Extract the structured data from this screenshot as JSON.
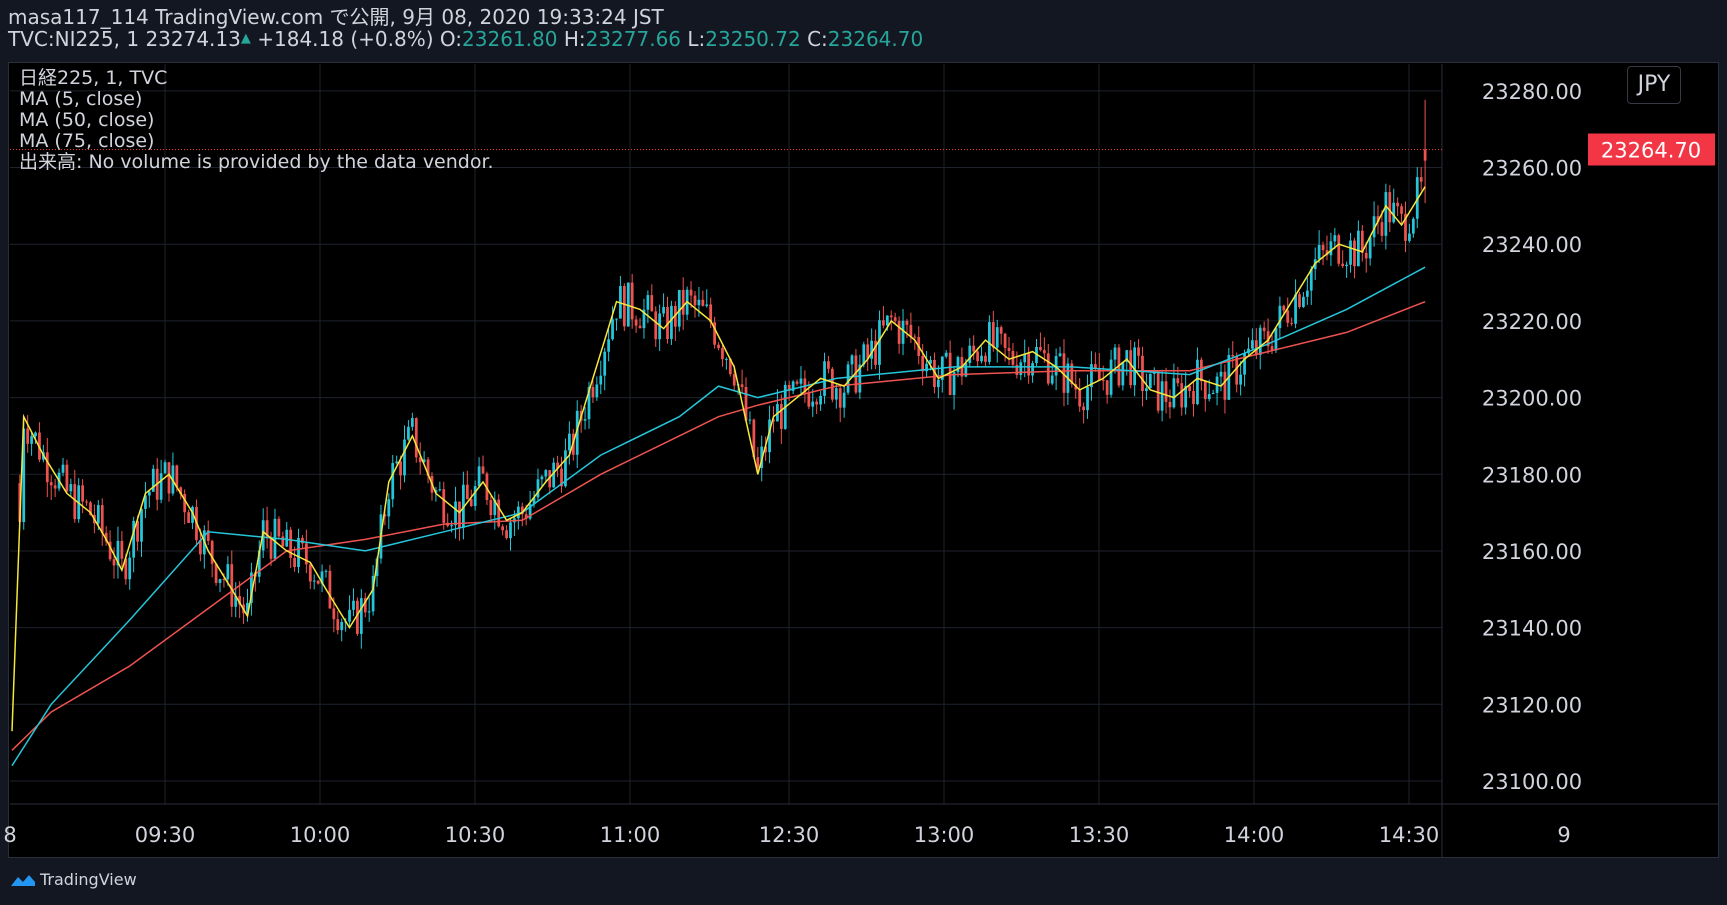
{
  "header": {
    "line1": "masa117_114 TradingView.com で公開, 9月 08, 2020 19:33:24 JST",
    "symbol": "TVC:NI225, 1",
    "last": "23274.13",
    "change": "+184.18 (+0.8%)",
    "o_label": "O:",
    "o_val": "23261.80",
    "h_label": "H:",
    "h_val": "23277.66",
    "l_label": "L:",
    "l_val": "23250.72",
    "c_label": "C:",
    "c_val": "23264.70"
  },
  "legend": {
    "title": "日経225, 1, TVC",
    "ma5": "MA (5, close)",
    "ma50": "MA (50, close)",
    "ma75": "MA (75, close)",
    "volume": "出来高: No volume is provided by the data vendor."
  },
  "currency_button": "JPY",
  "last_price_label": "23264.70",
  "brand": "TradingView",
  "colors": {
    "up": "#26c6da",
    "down": "#ef5350",
    "ma5": "#f5e73b",
    "ma50": "#26c6da",
    "ma75": "#ef5350",
    "last_price_bg": "#f23645",
    "header_value": "#26a69a"
  },
  "chart_data": {
    "type": "candlestick",
    "ylim": [
      23094,
      23287
    ],
    "y_ticks": [
      23100,
      23120,
      23140,
      23160,
      23180,
      23200,
      23220,
      23240,
      23260,
      23280
    ],
    "y_tick_labels": [
      "23100.00",
      "23120.00",
      "23140.00",
      "23160.00",
      "23180.00",
      "23200.00",
      "23220.00",
      "23240.00",
      "23260.00",
      "23280.00"
    ],
    "x_tick_labels": [
      "8",
      "09:30",
      "10:00",
      "10:30",
      "11:00",
      "12:30",
      "13:00",
      "13:30",
      "14:00",
      "14:30",
      "9"
    ],
    "last_price": 23264.7,
    "ma5_points": [
      [
        0,
        23113
      ],
      [
        3,
        23195
      ],
      [
        8,
        23185
      ],
      [
        14,
        23175
      ],
      [
        20,
        23170
      ],
      [
        24,
        23163
      ],
      [
        28,
        23155
      ],
      [
        34,
        23175
      ],
      [
        40,
        23180
      ],
      [
        46,
        23170
      ],
      [
        50,
        23160
      ],
      [
        56,
        23150
      ],
      [
        60,
        23143
      ],
      [
        64,
        23165
      ],
      [
        70,
        23160
      ],
      [
        76,
        23157
      ],
      [
        80,
        23150
      ],
      [
        86,
        23140
      ],
      [
        92,
        23150
      ],
      [
        96,
        23178
      ],
      [
        102,
        23190
      ],
      [
        108,
        23175
      ],
      [
        114,
        23170
      ],
      [
        120,
        23178
      ],
      [
        126,
        23168
      ],
      [
        130,
        23170
      ],
      [
        136,
        23178
      ],
      [
        142,
        23185
      ],
      [
        148,
        23205
      ],
      [
        154,
        23225
      ],
      [
        160,
        23223
      ],
      [
        166,
        23218
      ],
      [
        172,
        23225
      ],
      [
        178,
        23220
      ],
      [
        184,
        23208
      ],
      [
        190,
        23180
      ],
      [
        194,
        23195
      ],
      [
        200,
        23200
      ],
      [
        206,
        23205
      ],
      [
        212,
        23203
      ],
      [
        218,
        23210
      ],
      [
        224,
        23220
      ],
      [
        230,
        23215
      ],
      [
        236,
        23205
      ],
      [
        242,
        23208
      ],
      [
        248,
        23215
      ],
      [
        254,
        23210
      ],
      [
        260,
        23212
      ],
      [
        266,
        23208
      ],
      [
        272,
        23202
      ],
      [
        278,
        23205
      ],
      [
        284,
        23210
      ],
      [
        290,
        23202
      ],
      [
        296,
        23200
      ],
      [
        302,
        23205
      ],
      [
        308,
        23203
      ],
      [
        314,
        23210
      ],
      [
        320,
        23215
      ],
      [
        326,
        23225
      ],
      [
        332,
        23235
      ],
      [
        338,
        23240
      ],
      [
        344,
        23238
      ],
      [
        350,
        23250
      ],
      [
        354,
        23245
      ],
      [
        360,
        23255
      ]
    ],
    "ma50_points": [
      [
        0,
        23104
      ],
      [
        10,
        23120
      ],
      [
        30,
        23142
      ],
      [
        50,
        23165
      ],
      [
        70,
        23163
      ],
      [
        90,
        23160
      ],
      [
        110,
        23165
      ],
      [
        130,
        23170
      ],
      [
        150,
        23185
      ],
      [
        170,
        23195
      ],
      [
        180,
        23203
      ],
      [
        190,
        23200
      ],
      [
        210,
        23205
      ],
      [
        240,
        23208
      ],
      [
        270,
        23208
      ],
      [
        300,
        23206
      ],
      [
        320,
        23214
      ],
      [
        340,
        23223
      ],
      [
        360,
        23234
      ]
    ],
    "ma75_points": [
      [
        0,
        23108
      ],
      [
        10,
        23118
      ],
      [
        30,
        23130
      ],
      [
        50,
        23145
      ],
      [
        70,
        23160
      ],
      [
        90,
        23163
      ],
      [
        110,
        23167
      ],
      [
        130,
        23168
      ],
      [
        150,
        23180
      ],
      [
        170,
        23190
      ],
      [
        180,
        23195
      ],
      [
        190,
        23198
      ],
      [
        210,
        23203
      ],
      [
        240,
        23206
      ],
      [
        270,
        23207
      ],
      [
        300,
        23207
      ],
      [
        320,
        23212
      ],
      [
        340,
        23217
      ],
      [
        360,
        23225
      ]
    ]
  }
}
